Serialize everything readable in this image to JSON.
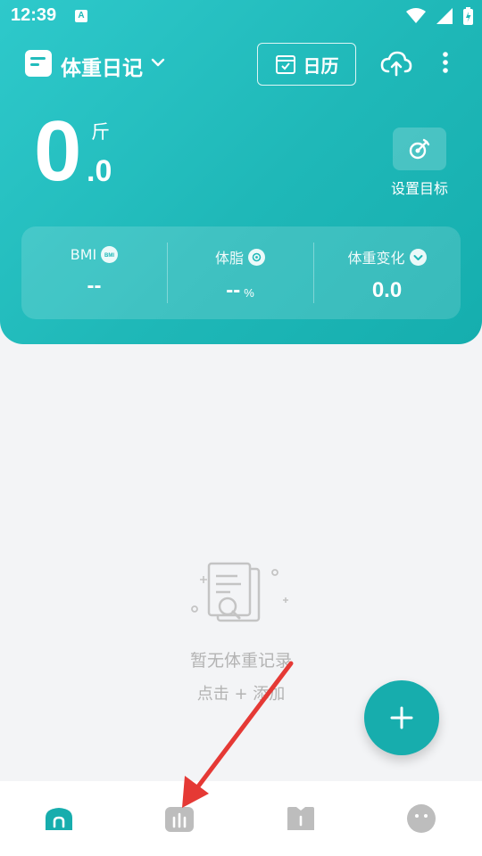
{
  "status_bar": {
    "time": "12:39",
    "notification_badge": "A"
  },
  "toolbar": {
    "title": "体重日记",
    "calendar_label": "日历"
  },
  "weight": {
    "integer": "0",
    "decimal": ".0",
    "unit": "斤"
  },
  "goal": {
    "label": "设置目标"
  },
  "stats": [
    {
      "title": "BMI",
      "value": "--",
      "icon": "bmi-icon"
    },
    {
      "title": "体脂",
      "value": "--",
      "unit": "%",
      "icon": "fat-icon"
    },
    {
      "title": "体重变化",
      "value": "0.0",
      "icon": "chevron-down-circle-icon"
    }
  ],
  "empty_state": {
    "title": "暂无体重记录",
    "hint": "点击 + 添加"
  },
  "bottom_nav": [
    {
      "name": "home",
      "icon": "home-icon",
      "active": true
    },
    {
      "name": "chart",
      "icon": "chart-icon",
      "active": false
    },
    {
      "name": "book",
      "icon": "book-icon",
      "active": false
    },
    {
      "name": "profile",
      "icon": "face-icon",
      "active": false
    }
  ],
  "colors": {
    "primary": "#1fb8b8",
    "fab": "#17adad",
    "annotation_arrow": "#e53935"
  }
}
